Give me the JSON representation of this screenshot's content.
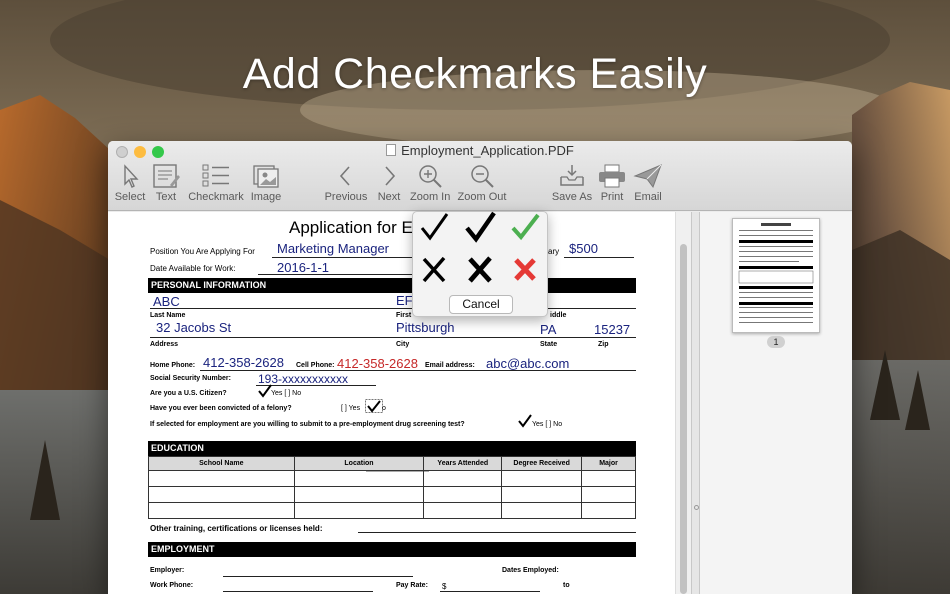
{
  "headline": "Add Checkmarks Easily",
  "window": {
    "title": "Employment_Application.PDF"
  },
  "toolbar": {
    "select": "Select",
    "text": "Text",
    "checkmark": "Checkmark",
    "image": "Image",
    "previous": "Previous",
    "next": "Next",
    "zoom_in": "Zoom In",
    "zoom_out": "Zoom Out",
    "save_as": "Save As",
    "print": "Print",
    "email": "Email"
  },
  "form": {
    "title": "Application for E",
    "position_label": "Position You Are Applying For",
    "position_value": "Marketing Manager",
    "salary_label": "ary",
    "salary_value": "$500",
    "date_label": "Date Available for Work:",
    "date_value": "2016-1-1",
    "section_personal": "PERSONAL INFORMATION",
    "last_name_value": "ABC",
    "first_name_value": "EF",
    "last_name_label": "Last Name",
    "first_label": "First",
    "middle_label": "iddle",
    "address_value": "32 Jacobs St",
    "city_value": "Pittsburgh",
    "state_value": "PA",
    "zip_value": "15237",
    "address_label": "Address",
    "city_label": "City",
    "state_label": "State",
    "zip_label": "Zip",
    "home_phone_label": "Home Phone:",
    "home_phone_value": "412-358-2628",
    "cell_phone_label": "Cell Phone:",
    "cell_phone_value": "412-358-2628",
    "email_label": "Email address:",
    "email_value": "abc@abc.com",
    "ssn_label": "Social Security Number:",
    "ssn_value": "193-xxxxxxxxxxx",
    "citizen_label": "Are you a U.S. Citizen?",
    "citizen_options": "Yes [ ]  No",
    "felony_label": "Have you ever been convicted of a felony?",
    "felony_yes": "[ ]  Yes",
    "felony_no": "o",
    "drug_label": "If selected for employment are you willing to submit to a pre-employment drug screening test?",
    "drug_options": "Yes [ ]  No",
    "section_education": "EDUCATION",
    "education_columns": [
      "School Name",
      "Location",
      "Years Attended",
      "Degree Received",
      "Major"
    ],
    "other_training_label": "Other training, certifications or licenses held:",
    "section_employment": "EMPLOYMENT",
    "employer_label": "Employer:",
    "dates_employed_label": "Dates Employed:",
    "work_phone_label": "Work Phone:",
    "pay_rate_label": "Pay Rate:",
    "pay_rate_symbol": "$",
    "to_label": "to"
  },
  "checkmark_popup": {
    "options": [
      "black-check-thin",
      "black-check-bold",
      "green-check",
      "black-x-thin",
      "black-x-bold",
      "red-x"
    ],
    "cancel": "Cancel"
  },
  "rotate_controls": {
    "delete": "⊗",
    "rotate_left": "↺",
    "rotate_right": "↻"
  },
  "thumbnail": {
    "page_number": "1"
  },
  "colors": {
    "green_check": "#4caf50",
    "red_x": "#e53935",
    "ink_blue": "#1a237e",
    "ink_red": "#c62828",
    "close": "#fc605b",
    "minimize": "#fdbc40",
    "maximize": "#34c84a"
  }
}
